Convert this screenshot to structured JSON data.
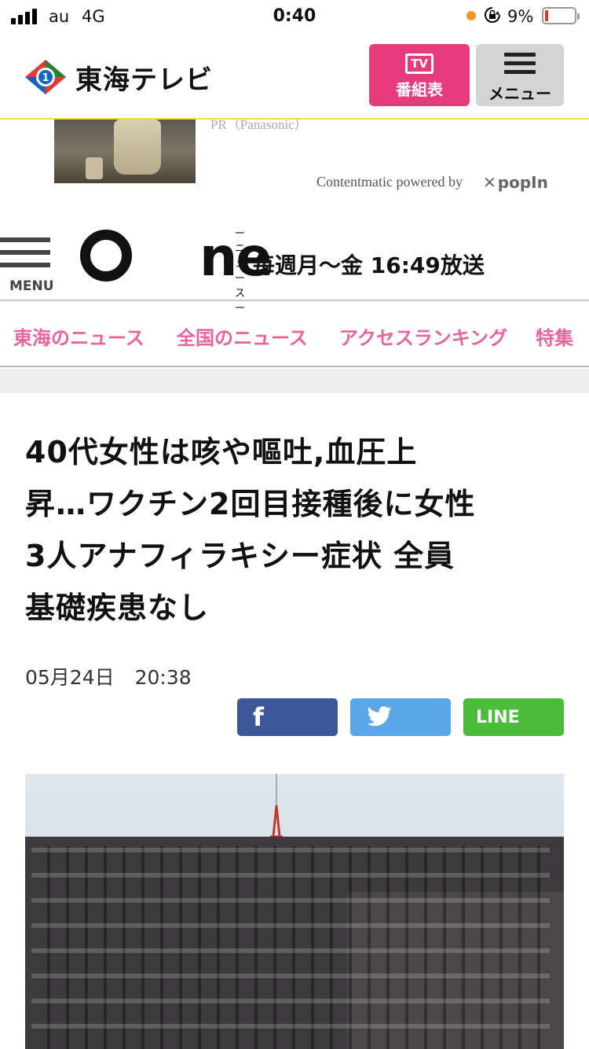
{
  "status_bar": {
    "carrier": "au",
    "network": "4G",
    "time": "0:40",
    "battery": "9%"
  },
  "header": {
    "site_name": "東海テレビ",
    "tv_badge": "TV",
    "tv_label": "番組表",
    "menu_label": "メニュー"
  },
  "ad": {
    "cut_text": "PR（Panasonic）",
    "credit": "Contentmatic powered by",
    "brand": "popIn"
  },
  "news": {
    "menu_label": "MENU",
    "logo_sub": "ー ニュース ー",
    "logo_text": "ne",
    "broadcast": "毎週月〜金 16:49放送"
  },
  "tabs": [
    "東海のニュース",
    "全国のニュース",
    "アクセスランキング",
    "特集"
  ],
  "article": {
    "title_lines": [
      "40代女性は咳や嘔吐,血圧上",
      "昇…ワクチン2回目接種後に女性",
      "3人アナフィラキシー症状 全員",
      "基礎疾患なし"
    ],
    "date": "05月24日",
    "time": "20:38"
  },
  "share": {
    "facebook": "f",
    "line": "LINE"
  },
  "colors": {
    "pink": "#e73c7b",
    "tab_pink": "#e8649a",
    "facebook": "#3b5998",
    "twitter": "#5ba6e6",
    "line": "#4bbd3b"
  }
}
